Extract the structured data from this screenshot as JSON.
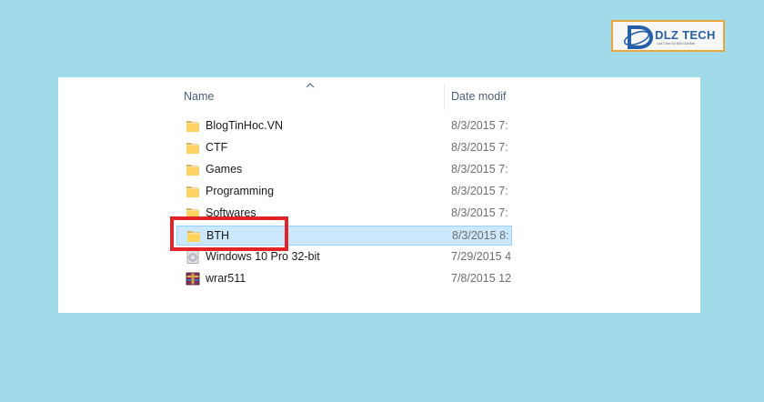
{
  "brand": {
    "name": "DLZ TECH",
    "tagline": "Lựa Chọn Số Một Của Bạn",
    "border_color": "#e8a63c",
    "text_color": "#2560a8"
  },
  "columns": {
    "name": "Name",
    "date": "Date modif"
  },
  "files": [
    {
      "name": "BlogTinHoc.VN",
      "date": "8/3/2015 7:",
      "icon": "folder-icon"
    },
    {
      "name": "CTF",
      "date": "8/3/2015 7:",
      "icon": "folder-icon"
    },
    {
      "name": "Games",
      "date": "8/3/2015 7:",
      "icon": "folder-icon"
    },
    {
      "name": "Programming",
      "date": "8/3/2015 7:",
      "icon": "folder-icon"
    },
    {
      "name": "Softwares",
      "date": "8/3/2015 7:",
      "icon": "folder-icon"
    },
    {
      "name": "BTH",
      "date": "8/3/2015 8:",
      "icon": "folder-icon",
      "selected": true
    },
    {
      "name": "Windows 10 Pro 32-bit",
      "date": "7/29/2015 4",
      "icon": "disc-image-icon"
    },
    {
      "name": "wrar511",
      "date": "7/8/2015 12",
      "icon": "winrar-icon"
    }
  ],
  "colors": {
    "background": "#a1dbea",
    "selection": "#cce8ff",
    "highlight_box": "#e0242a"
  }
}
